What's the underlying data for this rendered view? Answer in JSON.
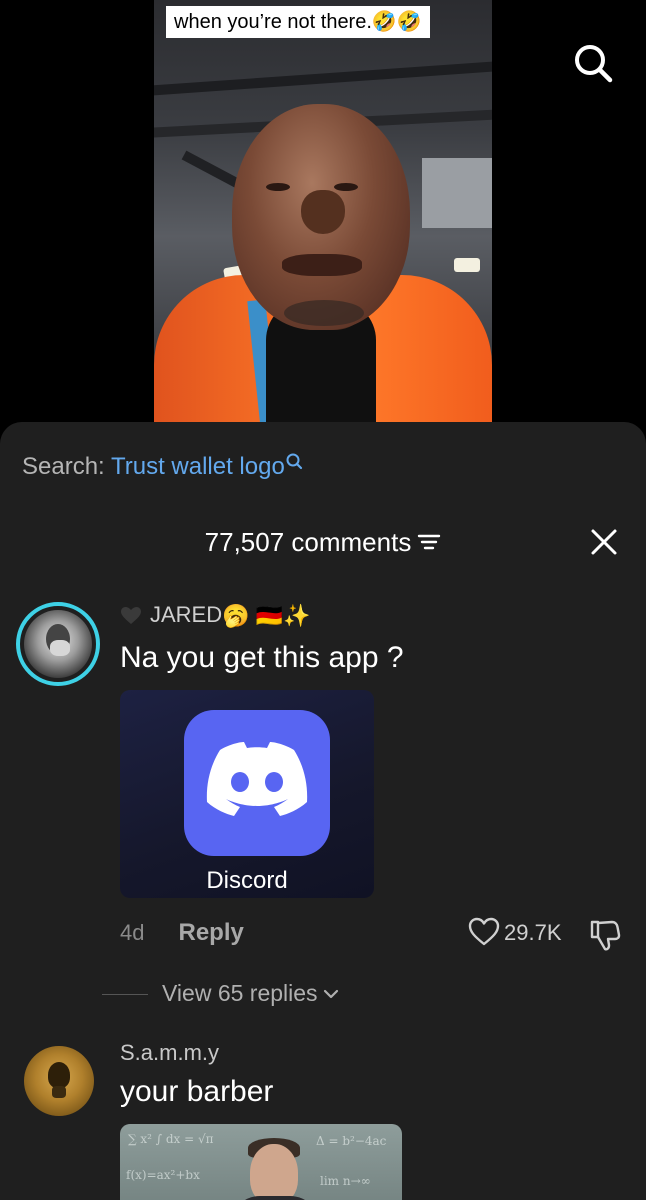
{
  "video": {
    "caption": "when you’re not there.🤣🤣"
  },
  "sheet": {
    "search_prefix": "Search:",
    "search_query": "Trust wallet logo",
    "comment_count": "77,507 comments"
  },
  "comments": [
    {
      "username": "JARED",
      "badges": [
        "🥱",
        "🇩🇪",
        "✨"
      ],
      "text": "Na you get this app ?",
      "attachment_label": "Discord",
      "time": "4d",
      "reply_label": "Reply",
      "likes": "29.7K",
      "view_replies": "View 65 replies"
    },
    {
      "username": "S.a.m.m.y",
      "text": "your barber"
    }
  ],
  "colors": {
    "sheet_bg": "#1f1f1f",
    "link_blue": "#63a9ee",
    "ring_cyan": "#3ed1e6",
    "discord_blurple": "#5865f2"
  },
  "icons": {
    "search": "search-icon",
    "close": "close-icon",
    "filter": "filter-icon",
    "like": "heart-icon",
    "dislike": "thumbs-down-icon",
    "chevron": "chevron-down-icon"
  }
}
